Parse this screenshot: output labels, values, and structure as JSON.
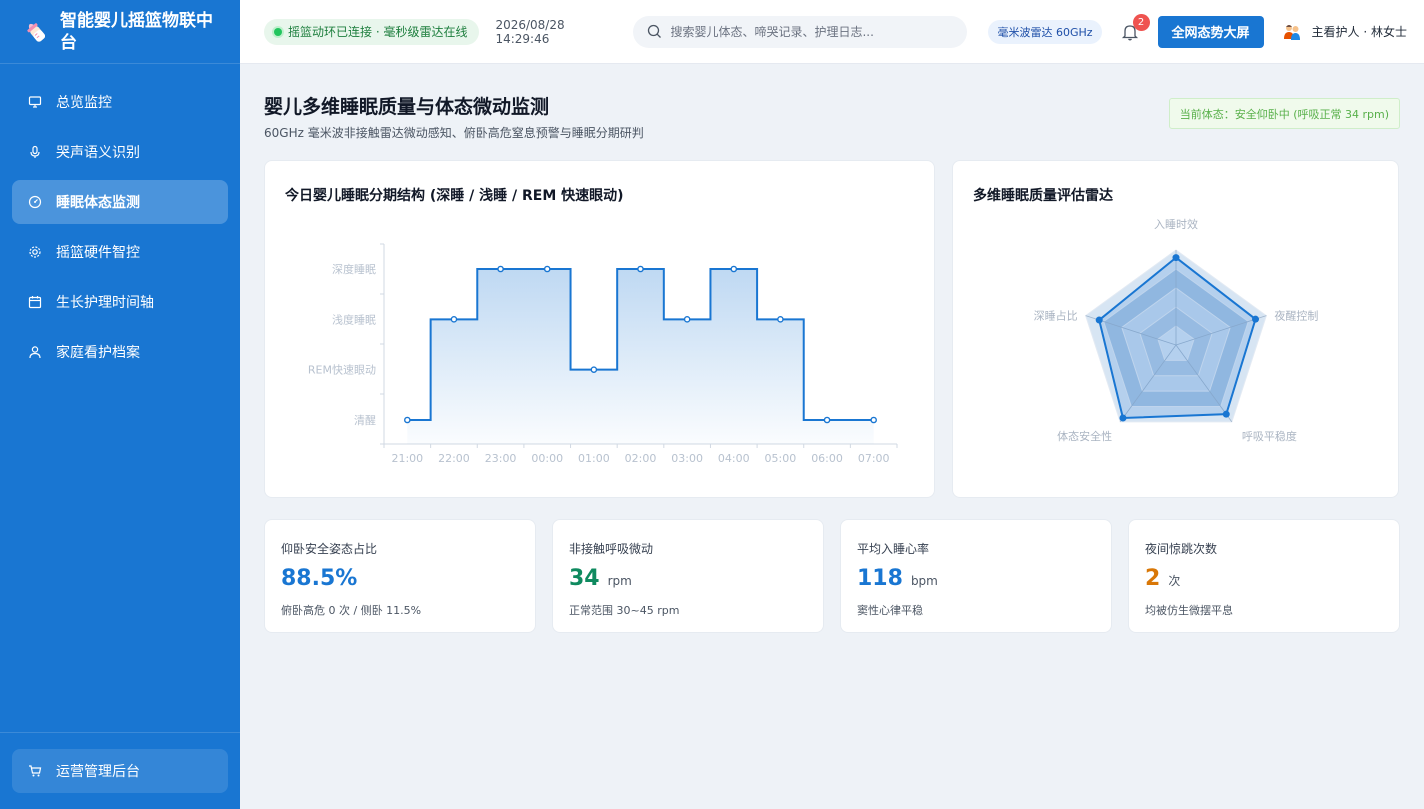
{
  "brand": {
    "title": "智能婴儿摇篮物联中台"
  },
  "sidebar": {
    "items": [
      {
        "label": "总览监控",
        "icon": "monitor-icon",
        "active": false
      },
      {
        "label": "哭声语义识别",
        "icon": "mic-icon",
        "active": false
      },
      {
        "label": "睡眠体态监测",
        "icon": "gauge-icon",
        "active": true
      },
      {
        "label": "摇篮硬件智控",
        "icon": "gear-icon",
        "active": false
      },
      {
        "label": "生长护理时间轴",
        "icon": "calendar-icon",
        "active": false
      },
      {
        "label": "家庭看护档案",
        "icon": "user-icon",
        "active": false
      }
    ],
    "bottom_label": "运营管理后台"
  },
  "header": {
    "status": "摇篮动环已连接 · 毫秒级雷达在线",
    "datetime": "2026/08/28 14:29:46",
    "search_placeholder": "搜索婴儿体态、啼哭记录、护理日志...",
    "radar_chip": "毫米波雷达 60GHz",
    "notification_count": "2",
    "big_screen_button": "全网态势大屏",
    "user": "主看护人 · 林女士"
  },
  "page": {
    "title": "婴儿多维睡眠质量与体态微动监测",
    "subtitle": "60GHz 毫米波非接触雷达微动感知、俯卧高危窒息预警与睡眠分期研判",
    "posture_badge": "当前体态：安全仰卧中 (呼吸正常 34 rpm)"
  },
  "sleep_chart": {
    "title": "今日婴儿睡眠分期结构 (深睡 / 浅睡 / REM 快速眼动)"
  },
  "radar_chart": {
    "title": "多维睡眠质量评估雷达"
  },
  "chart_data": [
    {
      "type": "line",
      "step": true,
      "title": "今日婴儿睡眠分期结构 (深睡 / 浅睡 / REM 快速眼动)",
      "categories": [
        "21:00",
        "22:00",
        "23:00",
        "00:00",
        "01:00",
        "02:00",
        "03:00",
        "04:00",
        "05:00",
        "06:00",
        "07:00"
      ],
      "y_levels": [
        "清醒",
        "REM快速眼动",
        "浅度睡眠",
        "深度睡眠"
      ],
      "values": [
        0,
        2,
        3,
        3,
        1,
        3,
        2,
        3,
        2,
        0,
        0
      ],
      "ylim": [
        0,
        3
      ],
      "color": "#1976d2",
      "grid": false
    },
    {
      "type": "radar",
      "title": "多维睡眠质量评估雷达",
      "axes": [
        "入睡时效",
        "夜醒控制",
        "呼吸平稳度",
        "体态安全性",
        "深睡占比"
      ],
      "values": [
        92,
        88,
        90,
        95,
        85
      ],
      "max": 100,
      "color": "#1976d2"
    }
  ],
  "kpis": [
    {
      "label": "仰卧安全姿态占比",
      "value": "88.5%",
      "unit": "",
      "sub": "俯卧高危 0 次 / 侧卧 11.5%",
      "color": "#1976d2"
    },
    {
      "label": "非接触呼吸微动",
      "value": "34",
      "unit": "rpm",
      "sub": "正常范围 30~45 rpm",
      "color": "#0f8a5f"
    },
    {
      "label": "平均入睡心率",
      "value": "118",
      "unit": "bpm",
      "sub": "窦性心律平稳",
      "color": "#1976d2"
    },
    {
      "label": "夜间惊跳次数",
      "value": "2",
      "unit": "次",
      "sub": "均被仿生微摆平息",
      "color": "#d97706"
    }
  ]
}
